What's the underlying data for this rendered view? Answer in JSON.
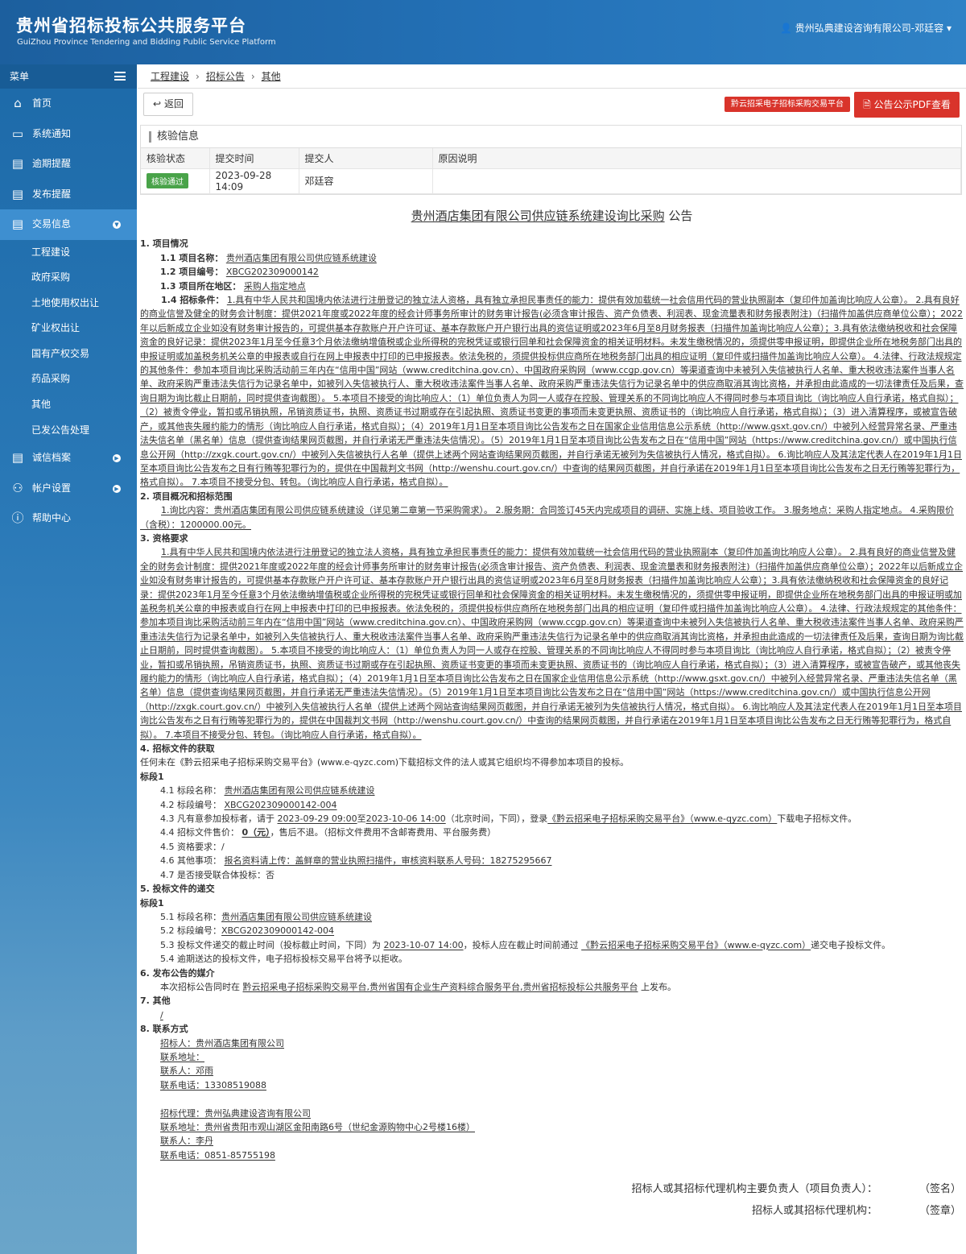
{
  "header": {
    "title": "贵州省招标投标公共服务平台",
    "subtitle": "GuiZhou Province Tendering and Bidding Public Service Platform",
    "user": "贵州弘典建设咨询有限公司-邓廷容"
  },
  "sidebar": {
    "menu_label": "菜单",
    "items": [
      {
        "label": "首页",
        "icon": "home-icon"
      },
      {
        "label": "系统通知",
        "icon": "monitor-icon"
      },
      {
        "label": "逾期提醒",
        "icon": "list-icon"
      },
      {
        "label": "发布提醒",
        "icon": "list-icon"
      },
      {
        "label": "交易信息",
        "icon": "list-icon"
      }
    ],
    "sub_items": [
      "工程建设",
      "政府采购",
      "土地使用权出让",
      "矿业权出让",
      "国有产权交易",
      "药品采购",
      "其他",
      "已发公告处理"
    ],
    "bottom_items": [
      {
        "label": "诚信档案",
        "icon": "archive-icon"
      },
      {
        "label": "帐户设置",
        "icon": "user-icon"
      },
      {
        "label": "帮助中心",
        "icon": "help-icon"
      }
    ]
  },
  "breadcrumb": [
    "工程建设",
    "招标公告",
    "其他"
  ],
  "actions": {
    "back": "返回",
    "platform": "黔云招采电子招标采购交易平台",
    "pdf": "公告公示PDF查看"
  },
  "verify": {
    "title": "核验信息",
    "headers": [
      "核验状态",
      "提交时间",
      "提交人",
      "原因说明"
    ],
    "status": "核验通过",
    "time": "2023-09-28 14:09",
    "submitter": "邓廷容",
    "reason": ""
  },
  "doc": {
    "title_u": "贵州酒店集团有限公司供应链系统建设询比采购",
    "title_s": "公告",
    "s1": "1. 项目情况",
    "s1_1_k": "1.1 项目名称：",
    "s1_1_v": "贵州酒店集团有限公司供应链系统建设",
    "s1_2_k": "1.2 项目编号：",
    "s1_2_v": "XBCG202309000142",
    "s1_3_k": "1.3 项目所在地区：",
    "s1_3_v": "采购人指定地点",
    "s1_4_k": "1.4 招标条件：",
    "s1_4_v": "1.具有中华人民共和国境内依法进行注册登记的独立法人资格，具有独立承担民事责任的能力：提供有效加载统一社会信用代码的营业执照副本（复印件加盖询比响应人公章）。 2.具有良好的商业信誉及健全的财务会计制度：提供2021年度或2022年度的经会计师事务所审计的财务审计报告(必须含审计报告、资产负债表、利润表、现金流量表和财务报表附注)（扫描件加盖供应商单位公章）；2022年以后新成立企业如没有财务审计报告的，可提供基本存款账户开户许可证、基本存款账户开户银行出具的资信证明或2023年6月至8月财务报表（扫描件加盖询比响应人公章）；3.具有依法缴纳税收和社会保障资金的良好记录：提供2023年1月至今任意3个月依法缴纳增值税或企业所得税的完税凭证或银行回单和社会保障资金的相关证明材料。未发生缴税情况的，须提供零申报证明，即提供企业所在地税务部门出具的申报证明或加盖税务机关公章的申报表或自行在网上申报表中打印的已申报报表。依法免税的，须提供投标供应商所在地税务部门出具的相应证明（复印件或扫描件加盖询比响应人公章）。 4.法律、行政法规规定的其他条件：参加本项目询比采购活动前三年内在“信用中国”网站（www.creditchina.gov.cn）、中国政府采购网（www.ccgp.gov.cn）等渠道查询中未被列入失信被执行人名单、重大税收违法案件当事人名单、政府采购严重违法失信行为记录名单中，如被列入失信被执行人、重大税收违法案件当事人名单、政府采购严重违法失信行为记录名单中的供应商取消其询比资格，并承担由此造成的一切法律责任及后果，查询日期为询比截止日期前，同时提供查询截图）。 5.本项目不接受的询比响应人：（1）单位负责人为同一人或存在控股、管理关系的不同询比响应人不得同时参与本项目询比（询比响应人自行承诺，格式自拟）；（2）被责令停业，暂扣或吊销执照，吊销资质证书，执照、资质证书过期或存在引起执照、资质证书变更的事项而未变更执照、资质证书的（询比响应人自行承诺，格式自拟）；（3）进入清算程序，或被宣告破产，或其他丧失履约能力的情形（询比响应人自行承诺，格式自拟）；（4）2019年1月1日至本项目询比公告发布之日在国家企业信用信息公示系统（http://www.gsxt.gov.cn/）中被列入经营异常名录、严重违法失信名单（黑名单）信息（提供查询结果网页截图，并自行承诺无严重违法失信情况）。（5）2019年1月1日至本项目询比公告发布之日在“信用中国”网站（https://www.creditchina.gov.cn/）或中国执行信息公开网（http://zxgk.court.gov.cn/）中被列入失信被执行人名单（提供上述两个网站查询结果网页截图，并自行承诺无被列为失信被执行人情况，格式自拟）。 6.询比响应人及其法定代表人在2019年1月1日至本项目询比公告发布之日有行贿等犯罪行为的，提供在中国裁判文书网（http://wenshu.court.gov.cn/）中查询的结果网页截图，并自行承诺在2019年1月1日至本项目询比公告发布之日无行贿等犯罪行为，格式自拟）。 7.本项目不接受分包、转包。（询比响应人自行承诺，格式自拟）。",
    "s2": "2. 项目概况和招标范围",
    "s2_v": "1.询比内容：贵州酒店集团有限公司供应链系统建设（详见第二章第一节采购需求）。 2.服务期：合同签订45天内完成项目的调研、实施上线、项目验收工作。 3.服务地点：采购人指定地点。 4.采购限价（含税）：1200000.00元。",
    "s3": "3. 资格要求",
    "s3_v": "1.具有中华人民共和国境内依法进行注册登记的独立法人资格，具有独立承担民事责任的能力：提供有效加载统一社会信用代码的营业执照副本（复印件加盖询比响应人公章）。 2.具有良好的商业信誉及健全的财务会计制度：提供2021年度或2022年度的经会计师事务所审计的财务审计报告(必须含审计报告、资产负债表、利润表、现金流量表和财务报表附注)（扫描件加盖供应商单位公章）；2022年以后新成立企业如没有财务审计报告的，可提供基本存款账户开户许可证、基本存款账户开户银行出具的资信证明或2023年6月至8月财务报表（扫描件加盖询比响应人公章）；3.具有依法缴纳税收和社会保障资金的良好记录：提供2023年1月至今任意3个月依法缴纳增值税或企业所得税的完税凭证或银行回单和社会保障资金的相关证明材料。未发生缴税情况的，须提供零申报证明，即提供企业所在地税务部门出具的申报证明或加盖税务机关公章的申报表或自行在网上申报表中打印的已申报报表。依法免税的，须提供投标供应商所在地税务部门出具的相应证明（复印件或扫描件加盖询比响应人公章）。 4.法律、行政法规规定的其他条件：参加本项目询比采购活动前三年内在“信用中国”网站（www.creditchina.gov.cn）、中国政府采购网（www.ccgp.gov.cn）等渠道查询中未被列入失信被执行人名单、重大税收违法案件当事人名单、政府采购严重违法失信行为记录名单中，如被列入失信被执行人、重大税收违法案件当事人名单、政府采购严重违法失信行为记录名单中的供应商取消其询比资格，并承担由此造成的一切法律责任及后果，查询日期为询比截止日期前，同时提供查询截图）。 5.本项目不接受的询比响应人：（1）单位负责人为同一人或存在控股、管理关系的不同询比响应人不得同时参与本项目询比（询比响应人自行承诺，格式自拟）；（2）被责令停业，暂扣或吊销执照，吊销资质证书，执照、资质证书过期或存在引起执照、资质证书变更的事项而未变更执照、资质证书的（询比响应人自行承诺，格式自拟）；（3）进入清算程序，或被宣告破产，或其他丧失履约能力的情形（询比响应人自行承诺，格式自拟）；（4）2019年1月1日至本项目询比公告发布之日在国家企业信用信息公示系统（http://www.gsxt.gov.cn/）中被列入经营异常名录、严重违法失信名单（黑名单）信息（提供查询结果网页截图，并自行承诺无严重违法失信情况）。（5）2019年1月1日至本项目询比公告发布之日在“信用中国”网站（https://www.creditchina.gov.cn/）或中国执行信息公开网（http://zxgk.court.gov.cn/）中被列入失信被执行人名单（提供上述两个网站查询结果网页截图，并自行承诺无被列为失信被执行人情况，格式自拟）。 6.询比响应人及其法定代表人在2019年1月1日至本项目询比公告发布之日有行贿等犯罪行为的，提供在中国裁判文书网（http://wenshu.court.gov.cn/）中查询的结果网页截图，并自行承诺在2019年1月1日至本项目询比公告发布之日无行贿等犯罪行为，格式自拟）。 7.本项目不接受分包、转包。（询比响应人自行承诺，格式自拟）。",
    "s4": "4. 招标文件的获取",
    "s4_v": "任何未在《黔云招采电子招标采购交易平台》(www.e-qyzc.com)下载招标文件的法人或其它组织均不得参加本项目的投标。",
    "lot": "标段1",
    "s4_1_k": "4.1 标段名称：",
    "s4_1_v": "贵州酒店集团有限公司供应链系统建设",
    "s4_2_k": "4.2 标段编号：",
    "s4_2_v": "XBCG202309000142-004",
    "s4_3_a": "4.3 凡有意参加投标者，请于",
    "s4_3_d1": "2023-09-29 09:00",
    "s4_3_b": "至",
    "s4_3_d2": "2023-10-06 14:00",
    "s4_3_c": "（北京时间，下同），登录",
    "s4_3_p": "《黔云招采电子招标采购交易平台》（www.e-qyzc.com）",
    "s4_3_e": "下载电子招标文件。",
    "s4_4_k": "4.4 招标文件售价：",
    "s4_4_v": "0（元）",
    "s4_4_e": "，售后不退。（招标文件费用不含邮寄费用、平台服务费）",
    "s4_5": "4.5 资格要求：/",
    "s4_6_k": "4.6 其他事项：",
    "s4_6_v": "报名资料请上传：盖鲜章的营业执照扫描件，审核资料联系人号码：18275295667",
    "s4_7": "4.7 是否接受联合体投标：否",
    "s5": "5. 投标文件的递交",
    "s5_1_k": "5.1 标段名称：",
    "s5_1_v": "贵州酒店集团有限公司供应链系统建设",
    "s5_2_k": "5.2 标段编号：",
    "s5_2_v": "XBCG202309000142-004",
    "s5_3_a": "5.3 投标文件递交的截止时间（投标截止时间，下同）为",
    "s5_3_d": "2023-10-07 14:00",
    "s5_3_b": "，投标人应在截止时间前通过",
    "s5_3_p": "《黔云招采电子招标采购交易平台》（www.e-qyzc.com）",
    "s5_3_e": "递交电子投标文件。",
    "s5_4": "5.4 逾期送达的投标文件，电子招标投标交易平台将予以拒收。",
    "s6": "6. 发布公告的媒介",
    "s6_a": "本次招标公告同时在",
    "s6_m": "黔云招采电子招标采购交易平台,贵州省国有企业生产资料综合服务平台,贵州省招标投标公共服务平台",
    "s6_e": "上发布。",
    "s7": "7. 其他",
    "s7_v": "/",
    "s8": "8. 联系方式",
    "c1": "招标人：贵州酒店集团有限公司",
    "c2": "联系地址：",
    "c3": "联系人：邓雨",
    "c4": "联系电话：13308519088",
    "c5": "招标代理：贵州弘典建设咨询有限公司",
    "c6": "联系地址：贵州省贵阳市观山湖区金阳南路6号（世纪金源购物中心2号楼16楼）",
    "c7": "联系人：李丹",
    "c8": "联系电话：0851-85755198",
    "sig1": "招标人或其招标代理机构主要负责人（项目负责人）：　　　　　（签名）",
    "sig2": "招标人或其招标代理机构：　　　　　（签章）"
  }
}
